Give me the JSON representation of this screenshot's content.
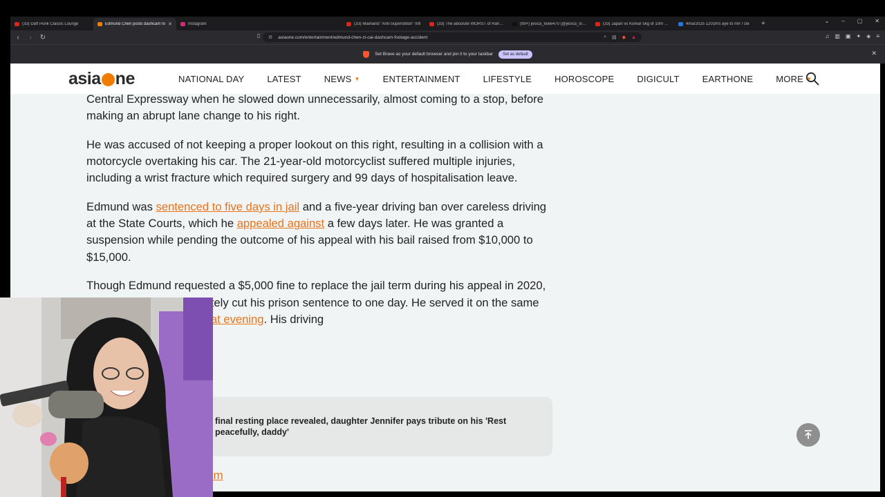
{
  "browser": {
    "tabs": [
      {
        "label": "(33) Daft Punk Classic Lounge",
        "color": "#e62117",
        "active": false
      },
      {
        "label": "Edmund Chen posts dashcam fo",
        "color": "#f07c00",
        "active": true
      },
      {
        "label": "Instagram",
        "color": "#d62976",
        "active": false
      },
      {
        "label": "",
        "color": "",
        "active": false
      },
      {
        "label": "(33) Mainland \"Anti-Superstition\" Infl",
        "color": "#e62117",
        "active": false
      },
      {
        "label": "(33) The absolute WORST of Rahul an",
        "color": "#e62117",
        "active": false
      },
      {
        "label": "(99+) jesica_lowe470 (@jesica_lowe4",
        "color": "#111111",
        "active": false
      },
      {
        "label": "(33) Japan vs Korea! 5kg of 10m Sup",
        "color": "#e62117",
        "active": false
      },
      {
        "label": "4mar2025 1201hrs aye to mrr / cle",
        "color": "#1877f2",
        "active": false
      }
    ],
    "url": "asiaone.com/entertainment/edmund-chen-zi-cai-dashcam-footage-accident",
    "infobar_text": "Set Brave as your default browser and pin it to your taskbar",
    "infobar_button": "Set as default"
  },
  "site": {
    "logo_pre": "asia",
    "logo_post": "ne",
    "nav": [
      {
        "label": "NATIONAL DAY",
        "dropdown": false
      },
      {
        "label": "LATEST",
        "dropdown": false
      },
      {
        "label": "NEWS",
        "dropdown": true
      },
      {
        "label": "ENTERTAINMENT",
        "dropdown": false
      },
      {
        "label": "LIFESTYLE",
        "dropdown": false
      },
      {
        "label": "HOROSCOPE",
        "dropdown": false
      },
      {
        "label": "DIGICULT",
        "dropdown": false
      },
      {
        "label": "EARTHONE",
        "dropdown": false
      },
      {
        "label": "MORE",
        "dropdown": true
      }
    ]
  },
  "article": {
    "p1": "Central Expressway when he slowed down unnecessarily, almost coming to a stop, before making an abrupt lane change to his right.",
    "p2": "He was accused of not keeping a proper lookout on this right, resulting in a collision with a motorcycle overtaking his car. The 21-year-old motorcyclist suffered multiple injuries, including a wrist fracture which required surgery and 99 days of hospitalisation leave.",
    "p3_a": "Edmund was ",
    "p3_link1": "sentenced to five days in jail",
    "p3_b": " and a five-year driving ban over careless driving at the State Courts, which he ",
    "p3_link2": "appealed against",
    "p3_c": " a few days later. He was granted a suspension while pending the outcome of his appeal with his bail raised from $10,000 to $15,000.",
    "p4_a": "Though Edmund requested a $5,000 fine to replace the jail term during his appeal in 2020, Justice Hri Kumar ultimately cut his prison sentence to one day. He served it on the same day and ",
    "p4_link": "was released that evening",
    "p4_b": ". His driving"
  },
  "related": {
    "text": "final resting place revealed, daughter Jennifer pays tribute on his 'Rest peacefully, daddy'"
  },
  "bottom_link": "om"
}
